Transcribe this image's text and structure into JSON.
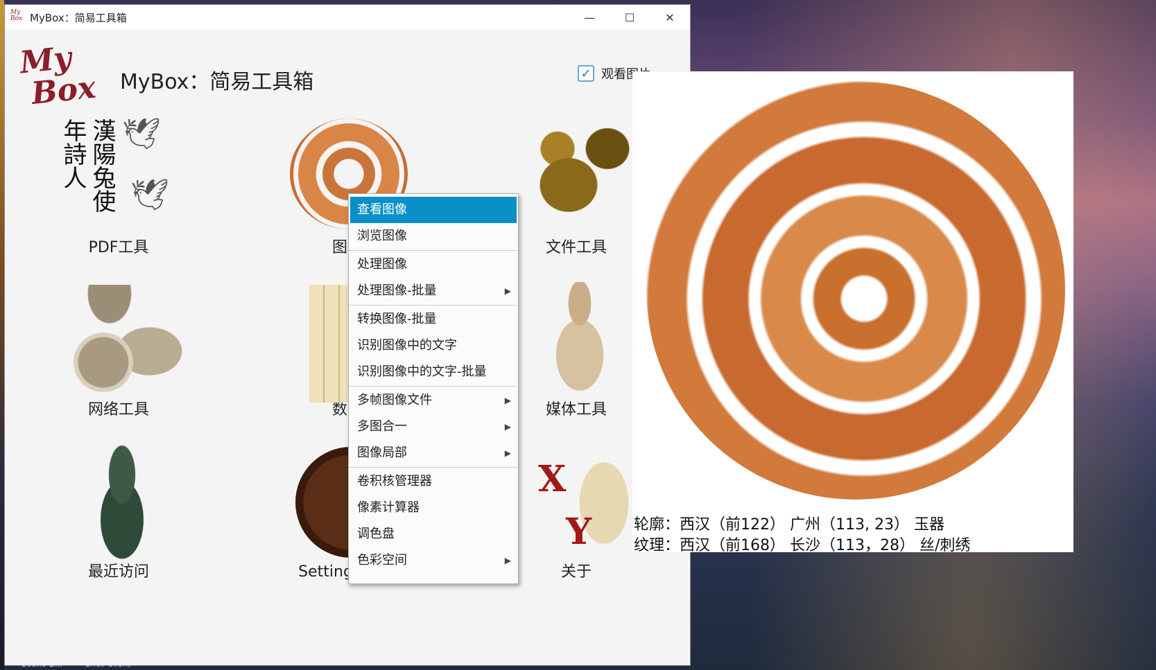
{
  "window": {
    "title": "MyBox：简易工具箱",
    "app_icon_text": "My Box",
    "minimize": "—",
    "maximize": "☐",
    "close": "✕"
  },
  "header": {
    "logo_line1": "My",
    "logo_line2": "Box",
    "title": "MyBox：简易工具箱",
    "checkbox_label": "观看图片",
    "checkbox_checked": true
  },
  "tools": [
    {
      "label": "PDF工具",
      "art": "calligraphy-cranes"
    },
    {
      "label": "图像",
      "art": "jade-disc"
    },
    {
      "label": "文件工具",
      "art": "bronze-dragon"
    },
    {
      "label": "网络工具",
      "art": "chariot"
    },
    {
      "label": "数据",
      "art": "bamboo-scrolls"
    },
    {
      "label": "媒体工具",
      "art": "pottery-figure"
    },
    {
      "label": "最近访问",
      "art": "bronze-vessel"
    },
    {
      "label": "Settings/设置",
      "art": "lacquer-plate"
    },
    {
      "label": "关于",
      "art": "jade-dragon"
    }
  ],
  "calligraphy_text": "漢陽兔使年詩人",
  "about_marks": [
    "X",
    "Y"
  ],
  "context_menu": {
    "items": [
      {
        "label": "查看图像",
        "active": true,
        "submenu": false
      },
      {
        "label": "浏览图像",
        "active": false,
        "submenu": false
      },
      {
        "separator": true
      },
      {
        "label": "处理图像",
        "active": false,
        "submenu": false
      },
      {
        "label": "处理图像-批量",
        "active": false,
        "submenu": true
      },
      {
        "separator": true
      },
      {
        "label": "转换图像-批量",
        "active": false,
        "submenu": false
      },
      {
        "label": "识别图像中的文字",
        "active": false,
        "submenu": false
      },
      {
        "label": "识别图像中的文字-批量",
        "active": false,
        "submenu": false
      },
      {
        "separator": true
      },
      {
        "label": "多帧图像文件",
        "active": false,
        "submenu": true
      },
      {
        "label": "多图合一",
        "active": false,
        "submenu": true
      },
      {
        "label": "图像局部",
        "active": false,
        "submenu": true
      },
      {
        "separator": true
      },
      {
        "label": "卷积核管理器",
        "active": false,
        "submenu": false
      },
      {
        "label": "像素计算器",
        "active": false,
        "submenu": false
      },
      {
        "label": "调色盘",
        "active": false,
        "submenu": false
      },
      {
        "label": "色彩空间",
        "active": false,
        "submenu": true
      }
    ]
  },
  "viewer": {
    "caption_line1": "轮廓：西汉（前122） 广州（113, 23） 玉器",
    "caption_line2": "纹理：西汉（前168） 长沙（113，28） 丝/刺绣"
  },
  "taskbar": {
    "item1": "Scene B...",
    "item2": "Shell Client"
  },
  "colors": {
    "menu_highlight": "#0a8fc8",
    "logo": "#8b1e2a",
    "checkbox_border": "#6aa7d6"
  }
}
